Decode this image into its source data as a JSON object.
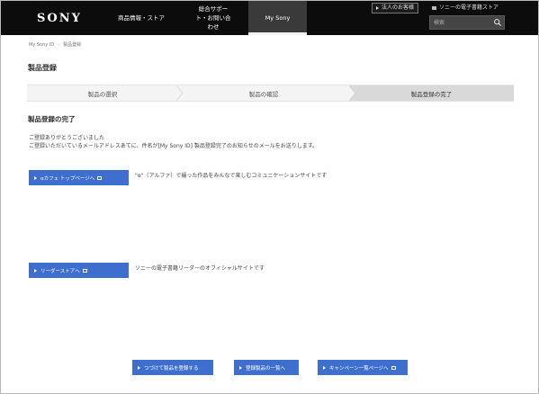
{
  "header": {
    "logo": "SONY",
    "nav": [
      {
        "label": "商品情報・ストア"
      },
      {
        "label": "総合サポート・お問い合わせ"
      },
      {
        "label": "My Sony"
      }
    ],
    "util_links": [
      "法人のお客様",
      "ソニーの電子書籍ストア"
    ],
    "search_placeholder": "検索"
  },
  "breadcrumb": [
    "My Sony ID",
    "製品登録"
  ],
  "page_title": "製品登録",
  "steps": [
    "製品の選択",
    "製品の確認",
    "製品登録の完了"
  ],
  "section_title": "製品登録の完了",
  "messages": [
    "ご登録ありがとうございました",
    "ご登録いただいているメールアドレスあてに、件名が[My Sony ID] 製品登録完了のお知らせのメールをお送りします。"
  ],
  "promos": [
    {
      "button": "αカフェ トップページへ",
      "text": "\"α\"（アルファ）で撮った作品をみんなで楽しむコミュニケーションサイトです"
    },
    {
      "button": "リーダーストアへ",
      "text": "ソニーの電子書籍リーダーのオフィシャルサイトです"
    }
  ],
  "footer_buttons": [
    "つづけて製品を登録する",
    "登録製品の一覧へ",
    "キャンペーン一覧ページへ"
  ],
  "colors": {
    "header_bg": "#0c0c0c",
    "button_blue": "#3f6fce",
    "step_current": "#d9d9da"
  }
}
